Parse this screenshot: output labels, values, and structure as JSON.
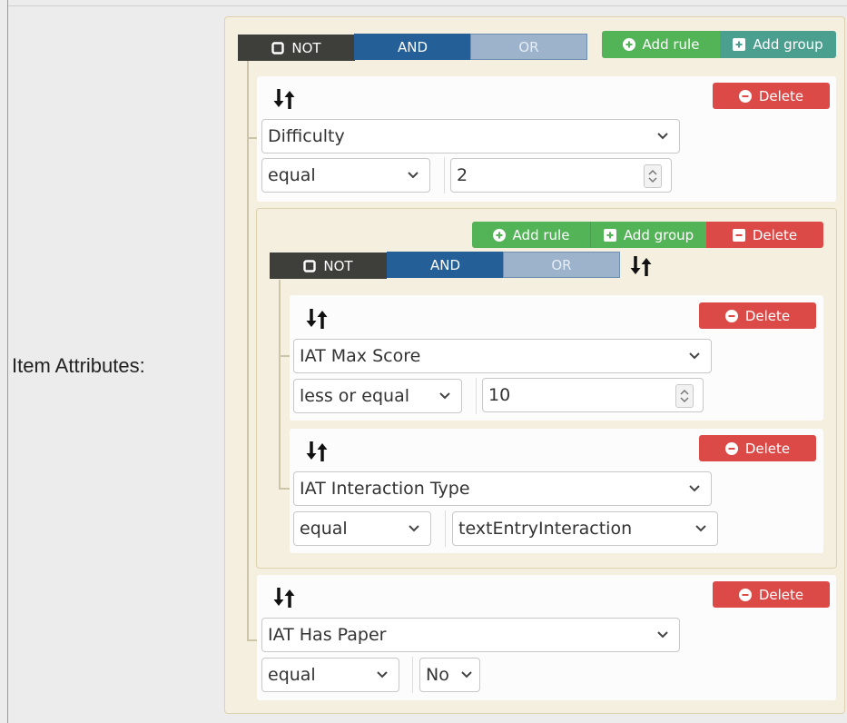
{
  "label": "Item Attributes:",
  "outer": {
    "toggle": {
      "not": "NOT",
      "and": "AND",
      "or": "OR"
    },
    "add_rule": "Add rule",
    "add_group": "Add group",
    "rules": [
      {
        "delete": "Delete",
        "field": "Difficulty",
        "operator": "equal",
        "value": "2"
      },
      {
        "delete": "Delete",
        "field": "IAT Has Paper",
        "operator": "equal",
        "value": "No"
      }
    ]
  },
  "inner": {
    "toggle": {
      "not": "NOT",
      "and": "AND",
      "or": "OR"
    },
    "add_rule": "Add rule",
    "add_group": "Add group",
    "delete": "Delete",
    "rules": [
      {
        "delete": "Delete",
        "field": "IAT Max Score",
        "operator": "less or equal",
        "value": "10"
      },
      {
        "delete": "Delete",
        "field": "IAT Interaction Type",
        "operator": "equal",
        "value": "textEntryInteraction"
      }
    ]
  },
  "colors": {
    "green": "#53b357",
    "teal": "#4a9f8f",
    "red": "#dc4a48",
    "dark": "#3e3e3a",
    "blue": "#245f98",
    "light_blue": "#9db3cc",
    "group_bg": "#f5efdf"
  }
}
